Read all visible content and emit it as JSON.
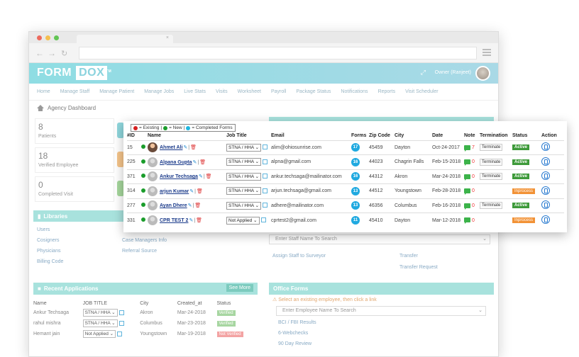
{
  "window": {
    "tab_close": "×"
  },
  "app": {
    "logo_left": "FORM",
    "logo_right": "DOX",
    "logo_tm": "TM",
    "owner": "Owner (Ranjeet)",
    "expand_icon": "expand-icon"
  },
  "menu": [
    "Home",
    "Manage Staff",
    "Manage Patient",
    "Manage Jobs",
    "Live Stats",
    "Visits",
    "Worksheet",
    "Payroll",
    "Package Status",
    "Notifications",
    "Reports",
    "Visit Scheduler"
  ],
  "breadcrumb": "Agency Dashboard",
  "stats": [
    {
      "value": "8",
      "label": "Patients"
    },
    {
      "value": "18",
      "label": "Verified Employee"
    },
    {
      "value": "0",
      "label": "Completed Visit"
    }
  ],
  "libraries": {
    "title": "Libraries",
    "left_links": [
      "Users",
      "Cosigners",
      "Physicians",
      "Billing Code"
    ],
    "right_links": [
      "Case Managers Info",
      "Referral Source"
    ]
  },
  "recent": {
    "title": "Recent Applications",
    "see_more": "See More",
    "columns": [
      "Name",
      "JOB TITLE",
      "City",
      "Created_at",
      "Status"
    ],
    "rows": [
      {
        "name": "Ankur Techsaga",
        "job": "STNA / HHA",
        "city": "Akron",
        "created": "Mar-24-2018",
        "status": "Verified"
      },
      {
        "name": "rahul mishra",
        "job": "STNA / HHA",
        "city": "Columbus",
        "created": "Mar-23-2018",
        "status": "Verified"
      },
      {
        "name": "Hemant jain",
        "job": "Not Applied",
        "city": "Youngstown",
        "created": "Mar-19-2018",
        "status": "Not Verified"
      }
    ]
  },
  "right": {
    "staff_search_placeholder": "Enter Staff Name To Search",
    "assign_link": "Assign Staff to Surveyor",
    "transfer": "Transfer",
    "transfer_request": "Transfer Request",
    "office_forms_title": "Office Forms",
    "office_warning": "Select an existing employee, then click a link",
    "employee_search_placeholder": "Enter Employee Name To Search",
    "form_links": [
      "BCI / FBI Results",
      "6-Webchecks",
      "90 Day Review"
    ]
  },
  "overlay": {
    "legend": {
      "existing": "= Existing",
      "new": "= New",
      "completed": "= Completed Forms",
      "sep": "|"
    },
    "columns": [
      "#ID",
      "",
      "Name",
      "Job Title",
      "Email",
      "Forms",
      "Zip Code",
      "City",
      "Date",
      "Note",
      "Termination",
      "Status",
      "Action"
    ],
    "rows": [
      {
        "id": "15",
        "name": "Ahmet Ali",
        "job": "STNA / HHA",
        "email": "alim@ohiosunrise.com",
        "forms": "17",
        "zip": "45459",
        "city": "Dayton",
        "date": "Oct-24-2017",
        "notes": "7",
        "termination": "Terminate",
        "status": "Active",
        "status_type": "active",
        "photo": true
      },
      {
        "id": "225",
        "name": "Alpana Gupta",
        "job": "STNA / HHA",
        "email": "alpna@gmail.com",
        "forms": "16",
        "zip": "44023",
        "city": "Chagrin Falls",
        "date": "Feb-15-2018",
        "notes": "0",
        "termination": "Terminate",
        "status": "Active",
        "status_type": "active",
        "photo": false
      },
      {
        "id": "371",
        "name": "Ankur Techsaga",
        "job": "STNA / HHA",
        "email": "ankur.techsaga@mailinator.com",
        "forms": "16",
        "zip": "44312",
        "city": "Akron",
        "date": "Mar-24-2018",
        "notes": "0",
        "termination": "Terminate",
        "status": "Active",
        "status_type": "active",
        "photo": false
      },
      {
        "id": "314",
        "name": "arjun Kumar",
        "job": "STNA / HHA",
        "email": "arjun.techsaga@gmail.com",
        "forms": "13",
        "zip": "44512",
        "city": "Youngstown",
        "date": "Feb-28-2018",
        "notes": "0",
        "termination": "",
        "status": "Inprocess",
        "status_type": "inprocess",
        "photo": false
      },
      {
        "id": "277",
        "name": "Ayan Dhere",
        "job": "STNA / HHA",
        "email": "adhere@mailinator.com",
        "forms": "13",
        "zip": "46356",
        "city": "Columbus",
        "date": "Feb-16-2018",
        "notes": "0",
        "termination": "Terminate",
        "status": "Active",
        "status_type": "active",
        "photo": false
      },
      {
        "id": "331",
        "name": "CPR TEST 2",
        "job": "Not Applied",
        "email": "cprtest2@gmail.com",
        "forms": "11",
        "zip": "45410",
        "city": "Dayton",
        "date": "Mar-12-2018",
        "notes": "0",
        "termination": "",
        "status": "Inprocess",
        "status_type": "inprocess",
        "photo": false
      }
    ]
  },
  "colors": {
    "accent": "#8fdde3",
    "panel": "#a8e2dd",
    "active": "#3e9a3a",
    "inprocess": "#f29236",
    "forms": "#1fa9e0",
    "existing": "#d62020",
    "new": "#1a9c2b",
    "completed": "#1fb7e0"
  }
}
